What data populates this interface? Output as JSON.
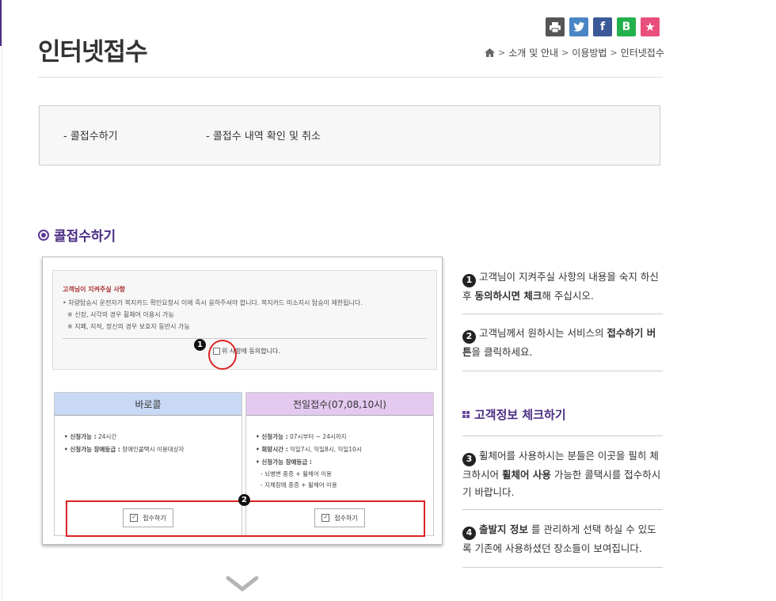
{
  "page": {
    "title": "인터넷접수",
    "share_buttons": [
      {
        "icon": "print-icon",
        "glyph": "⎙",
        "color": "#555555"
      },
      {
        "icon": "twitter-icon",
        "glyph": "🐦",
        "color": "#4a86c5"
      },
      {
        "icon": "facebook-icon",
        "glyph": "f",
        "color": "#3b5998"
      },
      {
        "icon": "band-icon",
        "glyph": "B",
        "color": "#22b14c"
      },
      {
        "icon": "star-icon",
        "glyph": "★",
        "color": "#e94f7c"
      }
    ],
    "breadcrumb": [
      "소개 및 안내",
      "이용방법",
      "인터넷접수"
    ]
  },
  "subnav": {
    "item1": "- 콜접수하기",
    "item2": "- 콜접수 내역 확인 및 취소"
  },
  "section": {
    "title": "콜접수하기"
  },
  "screenshot": {
    "notice_title": "고객님이 지켜주실 사항",
    "notice_line1": "• 차량탑승시 운전자가 복지카드 확인요청시 이에 즉시 응하주셔야 합니다. 복지카드 미소지시 탑승이 제한됩니다.",
    "notice_line2": "※ 신장, 시각의 경우 휠체어 이용시 가능",
    "notice_line3": "※ 지폐, 지적, 정신의 경우 보호자 동반시 가능",
    "agree_label": "위 사항에 동의합니다.",
    "badge1": "1",
    "badge2": "2",
    "card1": {
      "header": "바로콜",
      "header_color": "#c8d8f5",
      "line1_label": "• 신청가능 :",
      "line1_value": " 24시간",
      "line2_label": "• 신청가능 장애등급 :",
      "line2_value": " 장애인콜택시 이용대상자",
      "apply_label": "접수하기"
    },
    "card2": {
      "header": "전일접수(07,08,10시)",
      "header_color": "#e3c9f0",
      "line1_label": "• 신청가능 :",
      "line1_value": " 07시부터 ~ 24시까지",
      "line2_label": "• 희망시간 :",
      "line2_value": " 익일7시, 익일8시, 익일10시",
      "line3_label": "• 신청가능 장애등급 :",
      "line4": "- 뇌병변 중증 + 휠체어 이용",
      "line5": "- 지체장애 중증 + 휠체어 이용",
      "apply_label": "접수하기"
    }
  },
  "steps": {
    "s1_num": "1",
    "s1_text_a": "고객님이 지켜주실 사항의 내용을 숙지 하신 후 ",
    "s1_bold": "동의하시면 체크",
    "s1_text_b": "해 주십시오.",
    "s2_num": "2",
    "s2_text_a": "고객님께서 원하시는 서비스의 ",
    "s2_bold": "접수하기 버튼",
    "s2_text_b": "을 클릭하세요.",
    "subhead": "고객정보 체크하기",
    "s3_num": "3",
    "s3_text_a": "휠체어를 사용하시는 분들은 이곳을 필히 체크하시어 ",
    "s3_bold": "휠체어 사용",
    "s3_text_b": " 가능한 콜택시를 접수하시기 바랍니다.",
    "s4_num": "4",
    "s4_bold": "출발지 정보",
    "s4_text_b": " 를 관리하게 선택 하실 수 있도록 기존에 사용하셨던 장소들이 보여집니다."
  }
}
